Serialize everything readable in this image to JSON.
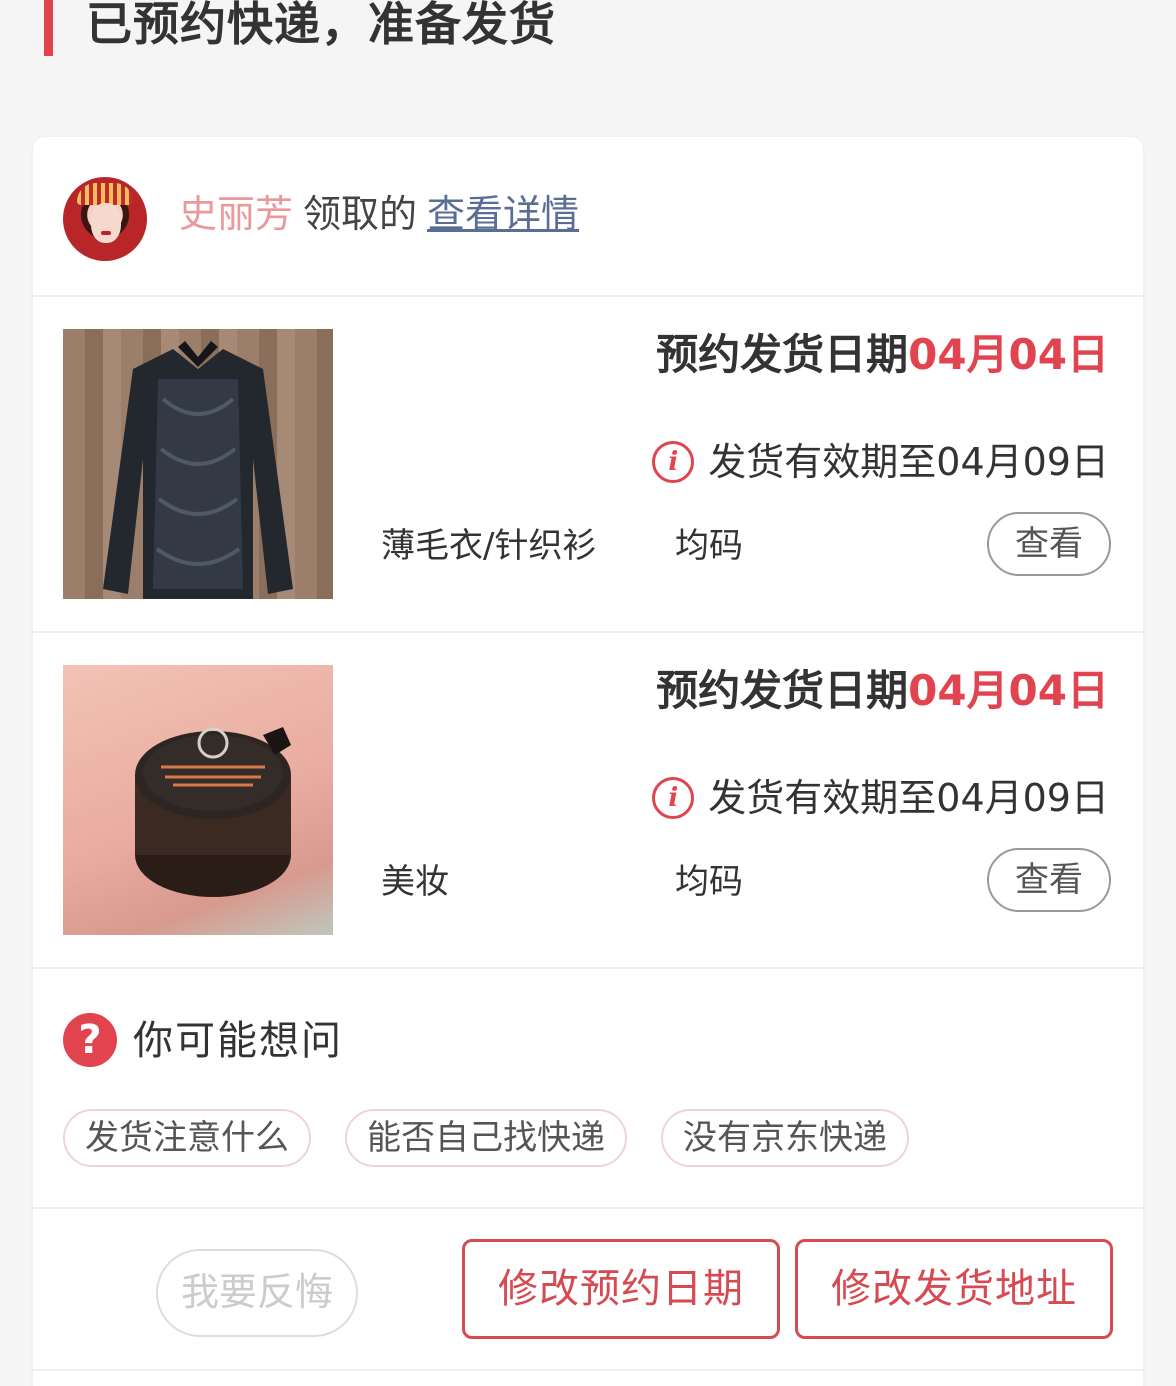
{
  "status": {
    "title": "已预约快递，准备发货",
    "accent_color": "#e2444f"
  },
  "claimer": {
    "avatar_icon": "avatar-photo",
    "name": "史丽芳",
    "action": "领取的",
    "link": "查看详情"
  },
  "items": [
    {
      "photo": "sweater-photo",
      "date_label": "预约发货日期",
      "date_value": "04月04日",
      "valid_text": "发货有效期至04月09日",
      "info_icon": "i",
      "category": "薄毛衣/针织衫",
      "size": "均码",
      "view_label": "查看"
    },
    {
      "photo": "cream-jar-photo",
      "date_label": "预约发货日期",
      "date_value": "04月04日",
      "valid_text": "发货有效期至04月09日",
      "info_icon": "i",
      "category": "美妆",
      "size": "均码",
      "view_label": "查看"
    }
  ],
  "faq": {
    "icon": "?",
    "title": "你可能想问",
    "chips": [
      "发货注意什么",
      "能否自己找快递",
      "没有京东快递"
    ]
  },
  "actions": {
    "regret_label": "我要反悔",
    "edit_date_label": "修改预约日期",
    "edit_address_label": "修改发货地址"
  }
}
